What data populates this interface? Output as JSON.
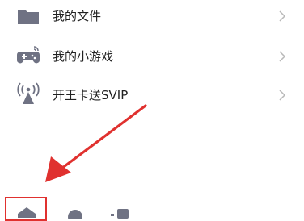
{
  "menu": {
    "items": [
      {
        "label": "我的文件",
        "icon": "folder-icon"
      },
      {
        "label": "我的小游戏",
        "icon": "gamepad-icon"
      },
      {
        "label": "开王卡送SVIP",
        "icon": "signal-tower-icon"
      }
    ]
  },
  "bottom_nav": {
    "items": [
      {
        "icon": "home-icon"
      },
      {
        "icon": "profile-icon"
      },
      {
        "icon": "apps-icon"
      }
    ]
  },
  "colors": {
    "icon_gray": "#6f7283",
    "arrow_red": "#e0312f",
    "chevron": "#b8b8b8"
  }
}
